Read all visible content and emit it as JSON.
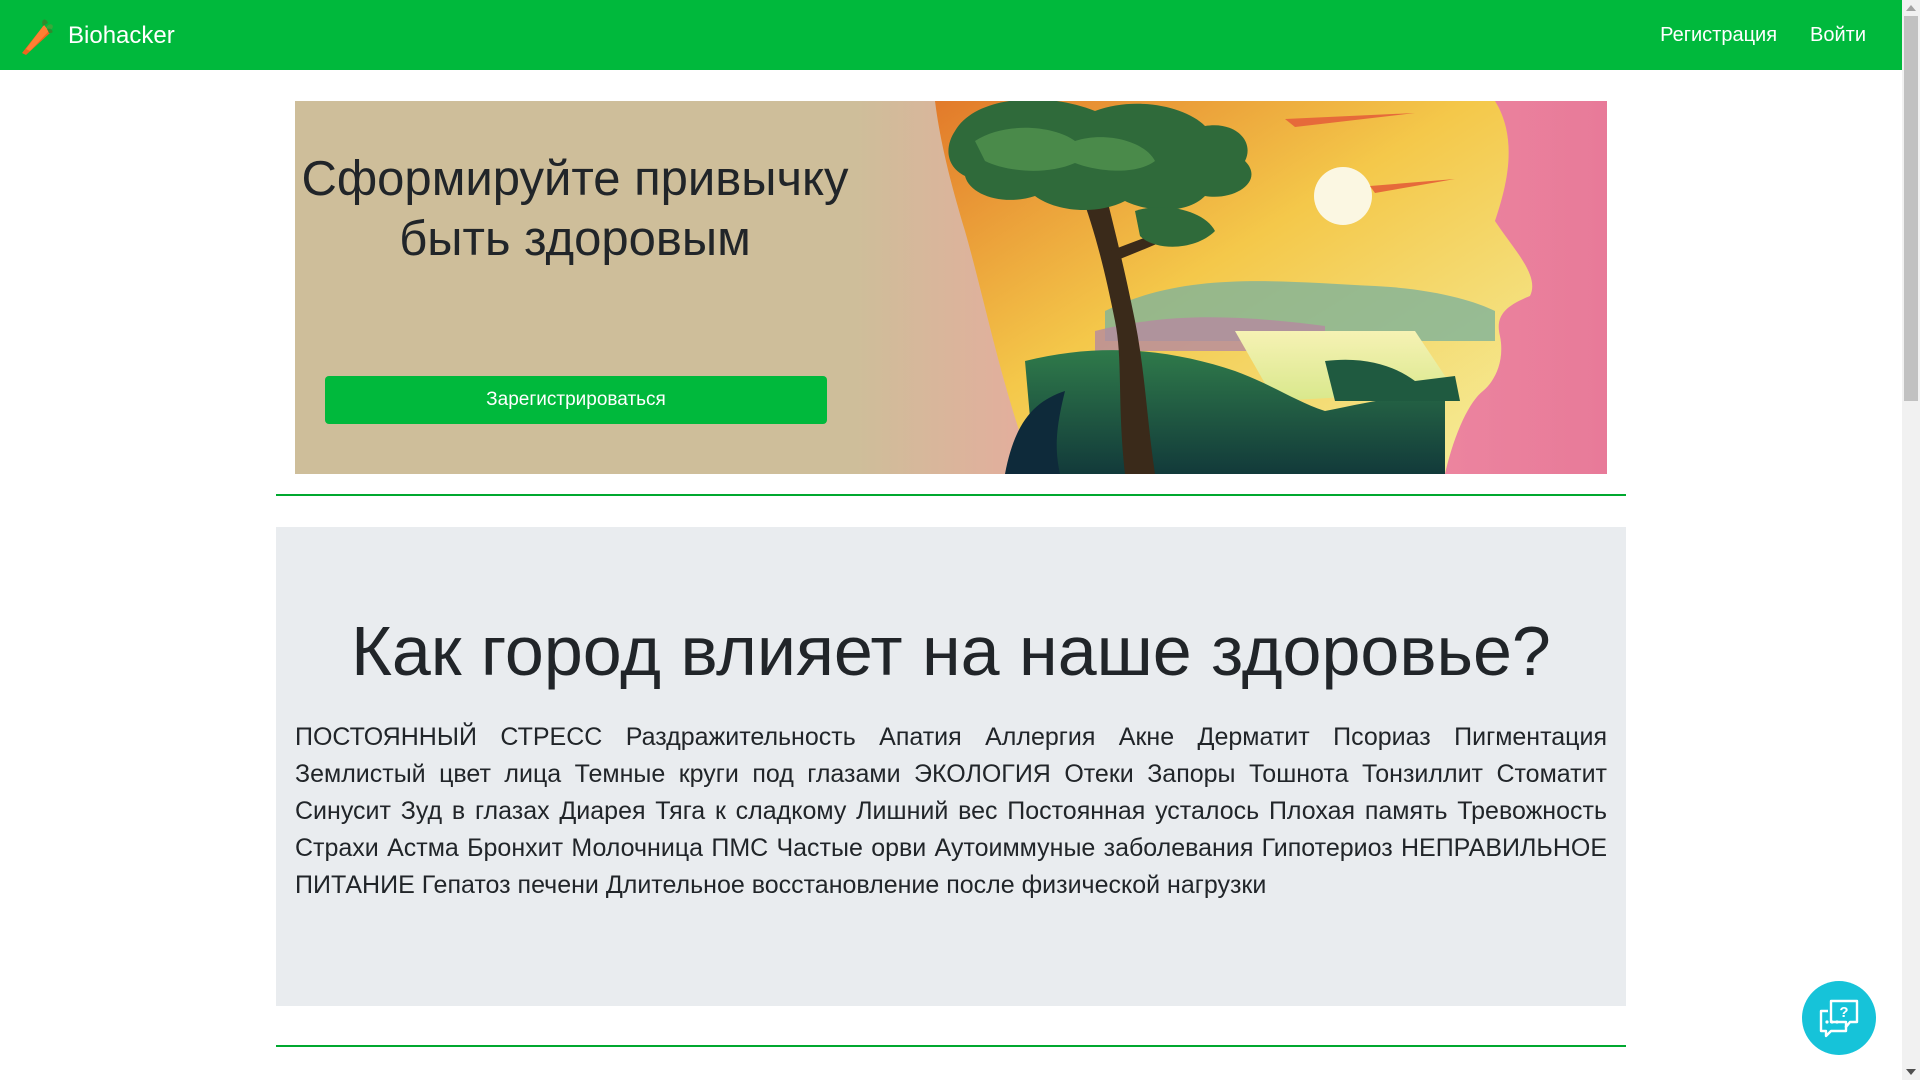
{
  "navbar": {
    "brand_name": "Biohacker",
    "logo_icon": "carrot-icon",
    "links": [
      {
        "label": "Регистрация"
      },
      {
        "label": "Войти"
      }
    ],
    "color": "#00b93c"
  },
  "hero": {
    "title_line1": "Сформируйте привычку",
    "title_line2": "быть здоровым",
    "button_label": "Зарегистрироваться",
    "image": "head-silhouette-landscape-illustration",
    "background": "#cebe9a"
  },
  "info": {
    "title": "Как город влияет на наше здоровье?",
    "text": "ПОСТОЯННЫЙ СТРЕСС Раздражительность Апатия Аллергия Акне Дерматит Псориаз Пигментация Землистый цвет лица Темные круги под глазами ЭКОЛОГИЯ Отеки Запоры Тошнота Тонзиллит Стоматит Синусит Зуд в глазах Диарея Тяга к сладкому Лишний вес Постоянная усталось Плохая память Тревожность Страхи Астма Бронхит Молочница ПМС Частые орви Аутоиммуные заболевания Гипотериоз НЕПРАВИЛЬНОЕ ПИТАНИЕ Гепатоз печени Длительное восстановление после физической нагрузки",
    "background": "#e9ecef"
  },
  "help_widget": {
    "icon": "chat-question-icon",
    "color": "#16c3d9"
  }
}
